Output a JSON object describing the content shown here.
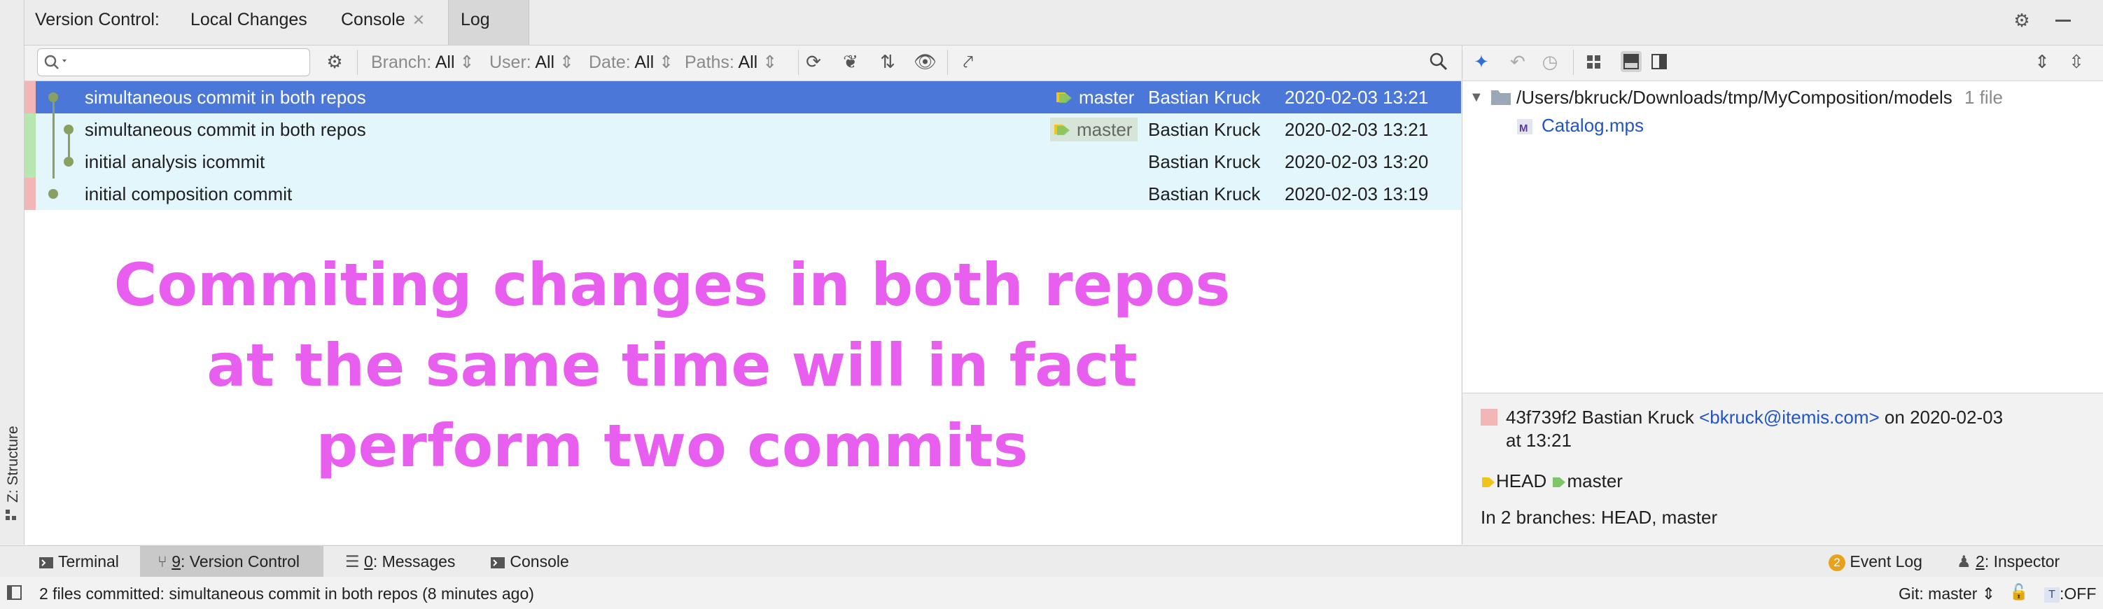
{
  "tabs": {
    "prefix": "Version Control:",
    "local_changes": "Local Changes",
    "console": "Console",
    "log": "Log"
  },
  "filters": {
    "branch_label": "Branch:",
    "branch_value": "All",
    "user_label": "User:",
    "user_value": "All",
    "date_label": "Date:",
    "date_value": "All",
    "paths_label": "Paths:",
    "paths_value": "All"
  },
  "commits": [
    {
      "subject": "simultaneous commit in both repos",
      "ref": "master",
      "author": "Bastian Kruck",
      "date": "2020-02-03 13:21"
    },
    {
      "subject": "simultaneous commit in both repos",
      "ref": "master",
      "author": "Bastian Kruck",
      "date": "2020-02-03 13:21"
    },
    {
      "subject": "initial analysis icommit",
      "ref": "",
      "author": "Bastian Kruck",
      "date": "2020-02-03 13:20"
    },
    {
      "subject": "initial composition commit",
      "ref": "",
      "author": "Bastian Kruck",
      "date": "2020-02-03 13:19"
    }
  ],
  "annotation": {
    "line1": "Commiting changes in both repos",
    "line2": "at the same time will in fact",
    "line3": "perform two commits"
  },
  "changes": {
    "folder_path": "/Users/bkruck/Downloads/tmp/MyComposition/models",
    "file_count": "1 file",
    "file_name": "Catalog.mps"
  },
  "details": {
    "hash": "43f739f2",
    "author": "Bastian Kruck",
    "email": "<bkruck@itemis.com>",
    "on": "on",
    "date": "2020-02-03",
    "at_time": "at 13:21",
    "ref_head": "HEAD",
    "ref_master": "master",
    "branches": "In 2 branches: HEAD, master"
  },
  "tool_windows": {
    "terminal": "Terminal",
    "version_control_num": "9",
    "version_control": ": Version Control",
    "messages_num": "0",
    "messages": ": Messages",
    "console": "Console",
    "event_log_badge": "2",
    "event_log": "Event Log",
    "inspector_num": "2",
    "inspector": ": Inspector",
    "structure": "Z: Structure"
  },
  "status": {
    "message": "2 files committed: simultaneous commit in both repos (8 minutes ago)",
    "git_branch": "Git: master",
    "off_label": ":OFF"
  },
  "colors": {
    "selection": "#4a77d8",
    "highlight_row": "#e3f6fb",
    "root_green": "#b8e6b0",
    "root_red": "#f3b6b6",
    "graph": "#8aa062",
    "annotation": "#e85fef",
    "tag_yellow": "#f0c419",
    "tag_green": "#7fc66a",
    "link": "#2155c6"
  }
}
